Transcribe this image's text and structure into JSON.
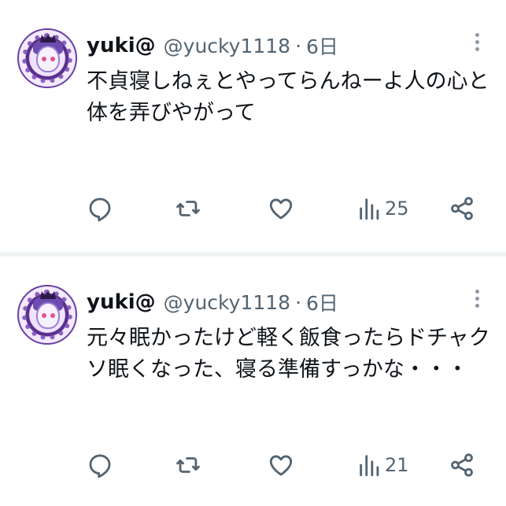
{
  "tweets": [
    {
      "name": "yuki@",
      "handle": "@yucky1118",
      "separator": "·",
      "time": "6日",
      "text_lines": [
        "不貞寝しねぇとやってらんねーよ人の心と",
        "体を弄びやがって"
      ],
      "views": "25",
      "icons": [
        "more-icon",
        "reply-icon",
        "retweet-icon",
        "like-icon",
        "views-icon",
        "share-icon"
      ]
    },
    {
      "name": "yuki@",
      "handle": "@yucky1118",
      "separator": "·",
      "time": "6日",
      "text_lines": [
        "元々眠かったけど軽く飯食ったらドチャク",
        "ソ眠くなった、寝る準備すっかな・・・"
      ],
      "views": "21",
      "icons": [
        "more-icon",
        "reply-icon",
        "retweet-icon",
        "like-icon",
        "views-icon",
        "share-icon"
      ]
    }
  ],
  "colors": {
    "text": "#0f1419",
    "secondary": "#536471",
    "divider": "#eff3f4"
  }
}
